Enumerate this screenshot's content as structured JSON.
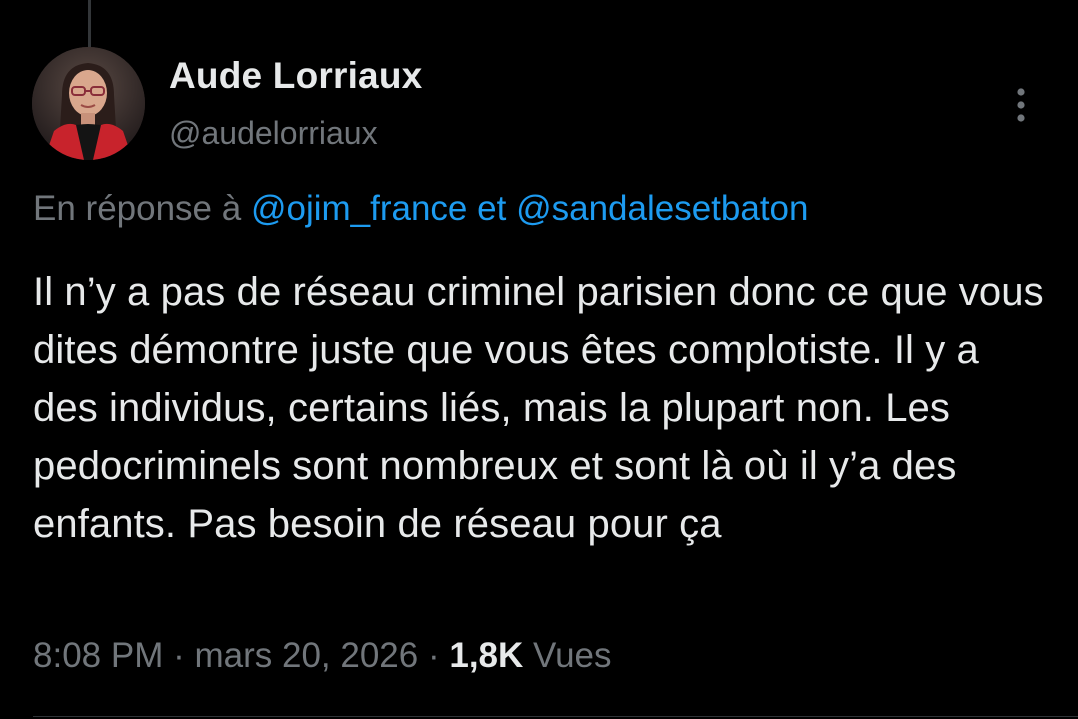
{
  "author": {
    "display_name": "Aude Lorriaux",
    "handle": "@audelorriaux",
    "avatar_icon": "profile-photo"
  },
  "reply_context": {
    "prefix": "En réponse à",
    "mentions": [
      "@ojim_france",
      "@sandalesetbaton"
    ],
    "joiner": "et"
  },
  "tweet": {
    "text": "Il n’y a pas de réseau criminel parisien donc ce que vous dites démontre juste que vous êtes complotiste. Il y a des individus, certains liés, mais la plupart non. Les pedocriminels sont nombreux et sont là où il y’a des enfants. Pas besoin de réseau pour ça"
  },
  "meta": {
    "time": "8:08 PM",
    "separator": "·",
    "date": "mars 20, 2026",
    "views_count": "1,8K",
    "views_label": "Vues"
  },
  "icons": {
    "more": "more-vertical-icon"
  },
  "colors": {
    "background": "#000000",
    "text_primary": "#e7e9ea",
    "text_secondary": "#71767b",
    "link": "#1d9bf0"
  }
}
